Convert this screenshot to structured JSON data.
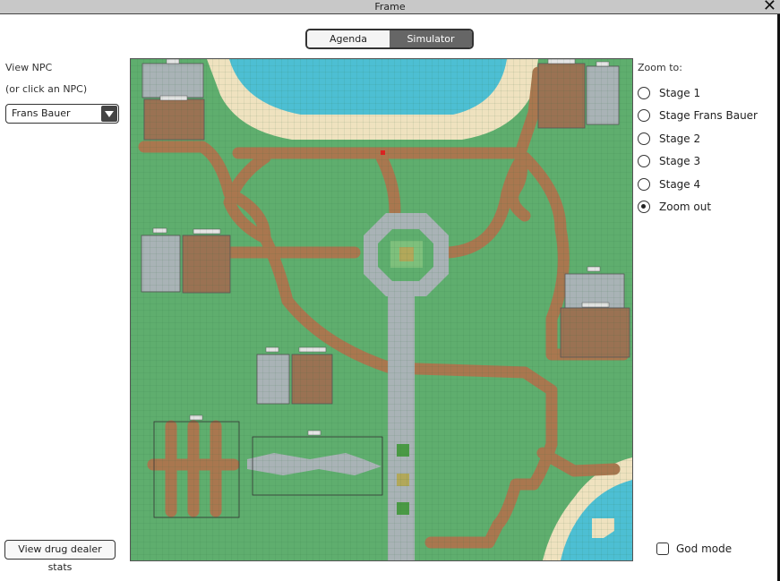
{
  "window": {
    "title": "Frame"
  },
  "tabs": [
    {
      "label": "Agenda",
      "active": false
    },
    {
      "label": "Simulator",
      "active": true
    }
  ],
  "npc": {
    "label": "View NPC",
    "hint": "(or click an NPC)",
    "selected": "Frans Bauer"
  },
  "stats_button": {
    "label": "View drug dealer stats"
  },
  "zoom": {
    "label": "Zoom to:",
    "options": [
      "Stage 1",
      "Stage Frans Bauer",
      "Stage 2",
      "Stage 3",
      "Stage 4",
      "Zoom out"
    ],
    "selected": "Zoom out"
  },
  "god_mode": {
    "label": "God mode",
    "checked": false
  },
  "colors": {
    "grass": "#5fae6e",
    "path": "#a9774f",
    "stone": "#a9b3b6",
    "water": "#4dbfd3",
    "sand": "#efe2bf",
    "stage": "#9a7253",
    "accent_active": "#666666"
  }
}
